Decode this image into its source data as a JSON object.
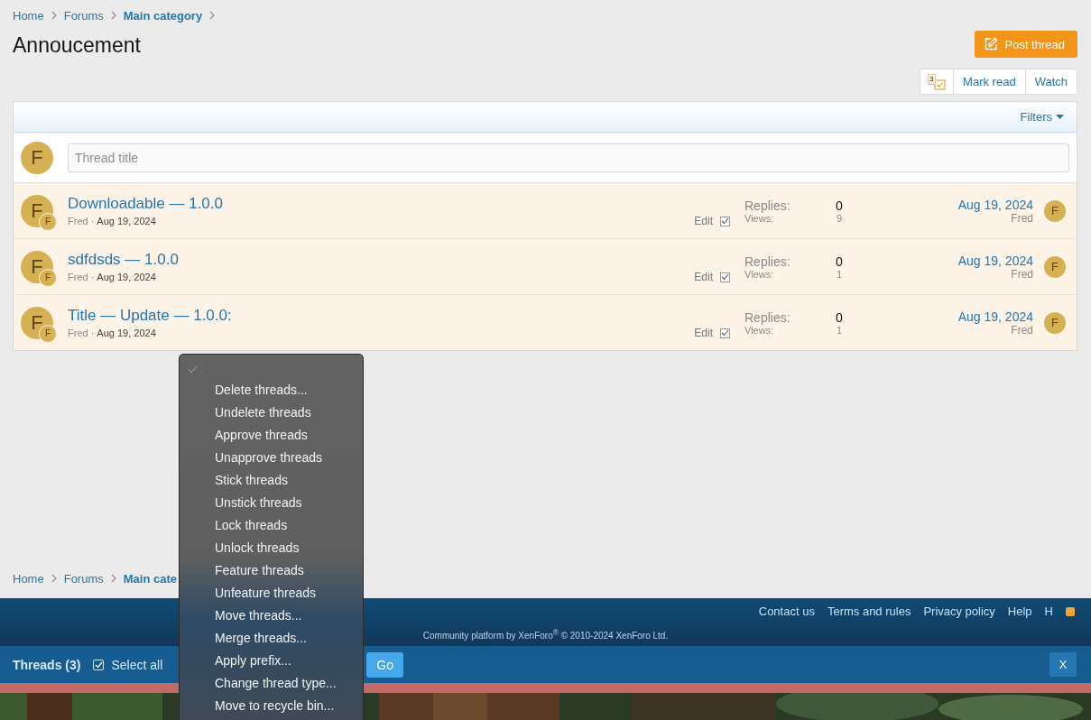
{
  "breadcrumb": [
    {
      "label": "Home",
      "current": false
    },
    {
      "label": "Forums",
      "current": false
    },
    {
      "label": "Main category",
      "current": true
    }
  ],
  "title": "Annoucement",
  "post_button": "Post thread",
  "actions": {
    "badge": "3",
    "buttons": [
      "Mark read",
      "Watch"
    ]
  },
  "filters": "Filters",
  "quick_thread": {
    "avatar": "F",
    "placeholder": "Thread title"
  },
  "threads": [
    {
      "avatar": "F",
      "small_avatar": "F",
      "title": "Downloadable — 1.0.0",
      "author": "Fred",
      "separator": "·",
      "date": "Aug 19, 2024",
      "edit": "Edit",
      "checked": true,
      "replies_label": "Replies:",
      "replies": "0",
      "views_label": "Views:",
      "views": "9",
      "last_date": "Aug 19, 2024",
      "last_user": "Fred",
      "last_avatar": "F"
    },
    {
      "avatar": "F",
      "small_avatar": "F",
      "title": "sdfdsds — 1.0.0",
      "author": "Fred",
      "separator": "·",
      "date": "Aug 19, 2024",
      "edit": "Edit",
      "checked": true,
      "replies_label": "Replies:",
      "replies": "0",
      "views_label": "Views:",
      "views": "1",
      "last_date": "Aug 19, 2024",
      "last_user": "Fred",
      "last_avatar": "F"
    },
    {
      "avatar": "F",
      "small_avatar": "F",
      "title": "Title — Update — 1.0.0:",
      "author": "Fred",
      "separator": "·",
      "date": "Aug 19, 2024",
      "edit": "Edit",
      "checked": true,
      "replies_label": "Replies:",
      "replies": "0",
      "views_label": "Views:",
      "views": "1",
      "last_date": "Aug 19, 2024",
      "last_user": "Fred",
      "last_avatar": "F"
    }
  ],
  "bottom_breadcrumb": [
    {
      "label": "Home",
      "current": false
    },
    {
      "label": "Forums",
      "current": false
    },
    {
      "label": "Main cate",
      "current": true
    }
  ],
  "footer": {
    "links": [
      "Contact us",
      "Terms and rules",
      "Privacy policy",
      "Help",
      "H"
    ],
    "copyright": "Community platform by XenForo$^{®}$ © 2010-2024 XenForo Ltd."
  },
  "selection_bar": {
    "label": "Threads (3)",
    "select_all": "Select all",
    "select_all_checked": true,
    "go": "Go",
    "close": "X"
  },
  "action_menu": {
    "blank_option_selected": true,
    "items": [
      {
        "label": "Delete threads...",
        "selected": false
      },
      {
        "label": "Undelete threads",
        "selected": false
      },
      {
        "label": "Approve threads",
        "selected": false
      },
      {
        "label": "Unapprove threads",
        "selected": false
      },
      {
        "label": "Stick threads",
        "selected": false
      },
      {
        "label": "Unstick threads",
        "selected": false
      },
      {
        "label": "Lock threads",
        "selected": false
      },
      {
        "label": "Unlock threads",
        "selected": false
      },
      {
        "label": "Feature threads",
        "selected": false
      },
      {
        "label": "Unfeature threads",
        "selected": false
      },
      {
        "label": "Move threads...",
        "selected": false
      },
      {
        "label": "Merge threads...",
        "selected": false
      },
      {
        "label": "Apply prefix...",
        "selected": false
      },
      {
        "label": "Change thread type...",
        "selected": false
      },
      {
        "label": "Move to recycle bin...",
        "selected": false
      }
    ]
  }
}
